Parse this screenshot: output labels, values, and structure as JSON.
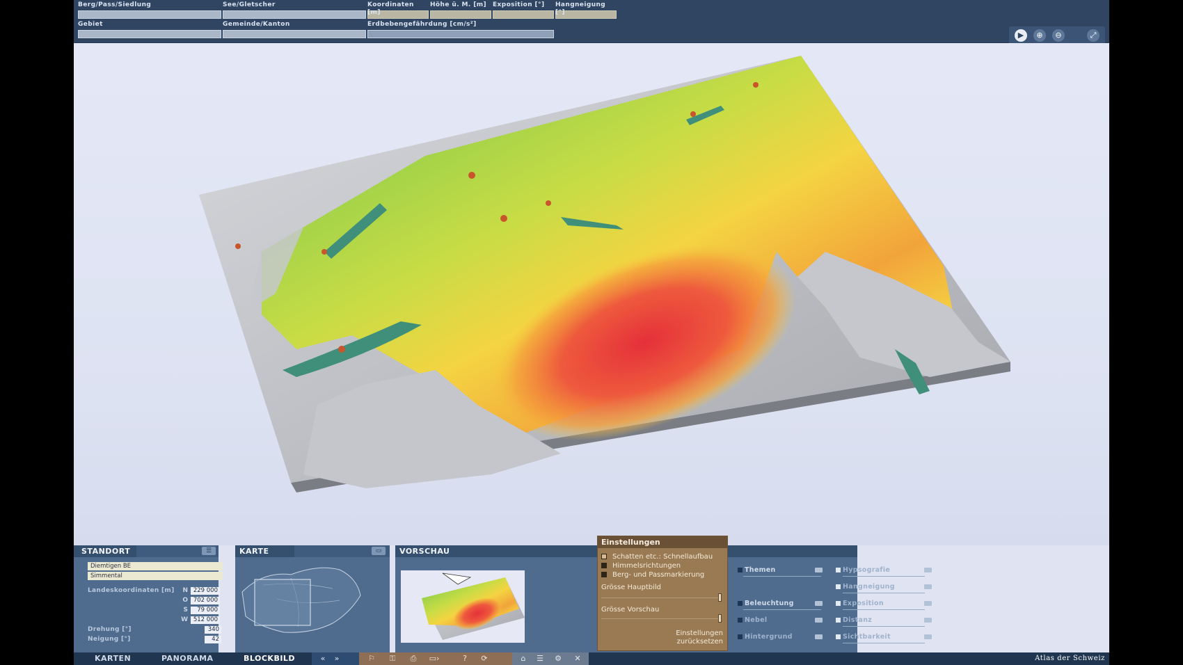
{
  "header": {
    "fields_row1": [
      {
        "label": "Berg/Pass/Siedlung",
        "value": ""
      },
      {
        "label": "See/Gletscher",
        "value": ""
      },
      {
        "label": "Koordinaten [m]",
        "value": ""
      },
      {
        "label": "Höhe ü. M. [m]",
        "value": ""
      },
      {
        "label": "Exposition [°]",
        "value": ""
      },
      {
        "label": "Hangneigung [°]",
        "value": ""
      }
    ],
    "fields_row2": [
      {
        "label": "Gebiet",
        "value": ""
      },
      {
        "label": "Gemeinde/Kanton",
        "value": ""
      },
      {
        "label": "Erdbebengefährdung [cm/s²]",
        "value": ""
      }
    ],
    "buttons": [
      {
        "name": "play-icon",
        "glyph": "▶"
      },
      {
        "name": "zoom-in-icon",
        "glyph": "⊕"
      },
      {
        "name": "zoom-out-icon",
        "glyph": "⊖"
      },
      {
        "name": "fullscreen-icon",
        "glyph": "⤢"
      }
    ]
  },
  "standort": {
    "title": "STANDORT",
    "location": "Diemtigen BE",
    "region": "Simmental",
    "coords_label": "Landeskoordinaten [m]",
    "coords": [
      {
        "key": "N",
        "value": "229 000"
      },
      {
        "key": "O",
        "value": "702 000"
      },
      {
        "key": "S",
        "value": "79 000"
      },
      {
        "key": "W",
        "value": "512 000"
      }
    ],
    "rotation_label": "Drehung [°]",
    "rotation_value": "340",
    "tilt_label": "Neigung [°]",
    "tilt_value": "42"
  },
  "karte": {
    "title": "KARTE"
  },
  "vorschau": {
    "title": "VORSCHAU"
  },
  "settings": {
    "title": "Einstellungen",
    "checkboxes": [
      {
        "label": "Schatten etc.: Schnellaufbau",
        "checked": true
      },
      {
        "label": "Himmelsrichtungen",
        "checked": false
      },
      {
        "label": "Berg- und Passmarkierung",
        "checked": false
      }
    ],
    "size_main": "Grösse Hauptbild",
    "size_preview": "Grösse Vorschau",
    "reset_line1": "Einstellungen",
    "reset_line2": "zurücksetzen"
  },
  "layers": {
    "left": [
      {
        "label": "Themen",
        "active": true
      },
      {
        "label": "Beleuchtung",
        "active": true
      },
      {
        "label": "Nebel",
        "active": false
      },
      {
        "label": "Hintergrund",
        "active": false
      }
    ],
    "right": [
      {
        "label": "Hypsografie",
        "active": false
      },
      {
        "label": "Hangneigung",
        "active": false
      },
      {
        "label": "Exposition",
        "active": false
      },
      {
        "label": "Distanz",
        "active": false
      },
      {
        "label": "Sichtbarkeit",
        "active": false
      }
    ]
  },
  "bottombar": {
    "tabs": [
      {
        "label": "KARTEN",
        "active": false
      },
      {
        "label": "PANORAMA",
        "active": false
      },
      {
        "label": "BLOCKBILD",
        "active": true
      }
    ],
    "brand": "Atlas der Schweiz"
  },
  "colors": {
    "header_bg": "#2f4562",
    "panel_bg": "#4f6c8f",
    "settings_bg": "#9a7a53",
    "bottombar_bg": "#1f3550",
    "hazard_low": "#8fd14f",
    "hazard_mid": "#f3d23f",
    "hazard_high": "#e8323a"
  }
}
